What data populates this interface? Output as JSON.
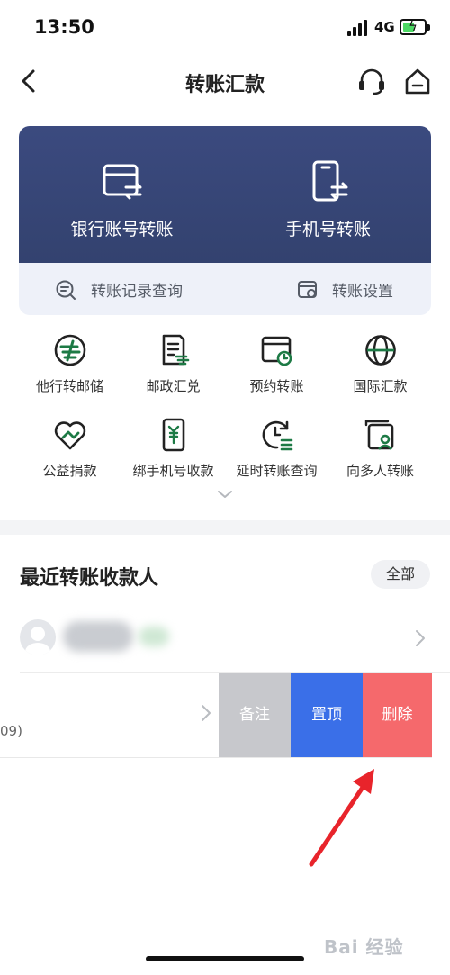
{
  "status_bar": {
    "time": "13:50",
    "network": "4G"
  },
  "nav": {
    "title": "转账汇款"
  },
  "hero": {
    "actions": [
      {
        "label": "银行账号转账",
        "icon": "card-transfer-icon"
      },
      {
        "label": "手机号转账",
        "icon": "phone-transfer-icon"
      }
    ],
    "links": [
      {
        "label": "转账记录查询",
        "icon": "search-record-icon"
      },
      {
        "label": "转账设置",
        "icon": "settings-card-icon"
      }
    ]
  },
  "grid": [
    {
      "label": "他行转邮储",
      "icon": "interbank-transfer-icon"
    },
    {
      "label": "邮政汇兑",
      "icon": "postal-remittance-icon"
    },
    {
      "label": "预约转账",
      "icon": "scheduled-transfer-icon"
    },
    {
      "label": "国际汇款",
      "icon": "globe-icon"
    },
    {
      "label": "公益捐款",
      "icon": "charity-heart-icon"
    },
    {
      "label": "绑手机号收款",
      "icon": "bind-phone-icon"
    },
    {
      "label": "延时转账查询",
      "icon": "delay-query-icon"
    },
    {
      "label": "向多人转账",
      "icon": "multi-transfer-icon"
    }
  ],
  "recent": {
    "title": "最近转账收款人",
    "all_label": "全部",
    "row2_partial_text": "09)",
    "swipe_actions": {
      "remark": "备注",
      "pin": "置顶",
      "delete": "删除"
    }
  },
  "watermark": {
    "text": "Bai 经验"
  },
  "colors": {
    "hero_blue": "#3b4a7f",
    "icon_green": "#1d7a45",
    "pin_blue": "#3a6fe8",
    "delete_red": "#f5696c",
    "remark_gray": "#c7c8cc",
    "arrow_red": "#e8242b"
  }
}
